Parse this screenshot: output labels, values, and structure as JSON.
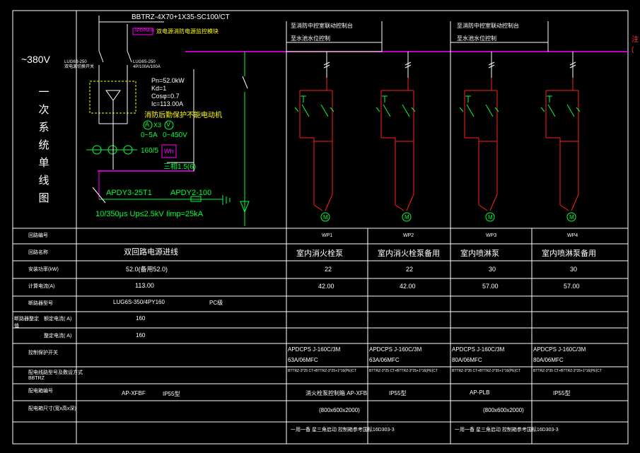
{
  "title": {
    "voltage": "~380V",
    "diagram_name_chars": [
      "一",
      "次",
      "系",
      "统",
      "单",
      "线",
      "图"
    ]
  },
  "incoming": {
    "cable_spec": "BBTRZ-4X70+1X35-SC100/CT",
    "switch_left": "LUG6S-250\n双电源切换开关",
    "switch_right": "LUG6S-250\n4P/100A/100A",
    "atse_tag": "APDPM-H",
    "magenta_note": "双电源消防电源监控模块",
    "params": [
      "Pn=52.0kW",
      "Kd=1",
      "Cosφ=0.7",
      "Ic=113.00A"
    ],
    "note": "消防后勤保护不能电动机",
    "meter_labels": [
      "A",
      "V"
    ],
    "meter_note1": "X3",
    "ranges": [
      "0~5A",
      "0~450V"
    ],
    "ct": "160/5",
    "kwh": "Wh",
    "ct3": "三相1.5(6)",
    "surge_left": "APDY3-25T1",
    "surge_right": "APDY2-100",
    "surge_spec": "10/350μs  Up≤2.5kV  Iimp=25kA"
  },
  "feeders": {
    "header_boxes": [
      {
        "line1": "至消防中控室联动控制台",
        "line2": "至水池水位控制"
      },
      {
        "line1": "至消防中控室联动控制台",
        "line2": "至水池水位控制"
      }
    ]
  },
  "table": {
    "row_labels": [
      "回路编号",
      "回路名称",
      "安装功率(kW)",
      "计算电流(A)",
      "断路器型号",
      "额定电流(  A)",
      "整定电流(  A)",
      "控制保护开关",
      "配电线路型号及敷设方式",
      "配电箱编号",
      "配电箱尺寸(宽x高x深)"
    ],
    "row_group_label": "断路器整定值",
    "row_sub_note": "BBTRZ",
    "main": {
      "name": "双回路电源进线",
      "power": "52.0(备用52.0)",
      "current": "113.00",
      "breaker": "LUG6S-350/4PY160",
      "breaker_suffix": "PC级",
      "rated": "160",
      "setting": "160",
      "box_no": "AP-XFBF",
      "box_ip": "IP55型"
    },
    "circuits": [
      {
        "no": "WP1",
        "name": "室内消火栓泵",
        "power": "22",
        "current": "42.00",
        "switch_a": "APDCPS J-160C/3M",
        "switch_b": "63A/06MFC",
        "cable": "BTTRZ-3*25 CT+BTTRZ-3*25+1*16(PE)CT"
      },
      {
        "no": "WP2",
        "name": "室内消火栓泵备用",
        "power": "22",
        "current": "42.00",
        "switch_a": "APDCPS J-160C/3M",
        "switch_b": "63A/06MFC",
        "cable": "BTTRZ-3*25 CT+BTTRZ-3*25+1*16(PE)CT"
      },
      {
        "no": "WP3",
        "name": "室内喷淋泵",
        "power": "30",
        "current": "57.00",
        "switch_a": "APDCPS J-160C/3M",
        "switch_b": "80A/06MFC",
        "cable": "BTTRZ-3*35 CT+BTTRZ-3*35+1*16(PE)CT"
      },
      {
        "no": "WP4",
        "name": "室内喷淋泵备用",
        "power": "30",
        "current": "57.00",
        "switch_a": "APDCPS J-160C/3M",
        "switch_b": "80A/06MFC",
        "cable": "BTTRZ-3*35 CT+BTTRZ-3*35+1*16(PE)CT"
      }
    ],
    "box_groups": [
      {
        "label": "消火栓泵控制箱 AP-XFB",
        "ip": "IP55型",
        "size": "(800x600x2000)",
        "note": "一用一备 星三角启动  控制箱参考国标16D303-3"
      },
      {
        "label": "AP-PLB",
        "ip": "IP55型",
        "size": "(800x600x2000)",
        "note": "一用一备 星三角启动  控制箱参考国标16D303-3"
      }
    ],
    "motor_label": "M"
  },
  "right_edge_note": "注\n(",
  "colors": {
    "bus": "#ff00ff",
    "wire_green": "#00ff3c",
    "wire_red": "#ff2020",
    "dash_yellow": "#ffff00",
    "table_line": "#ffffff",
    "text": "#ffffff"
  }
}
